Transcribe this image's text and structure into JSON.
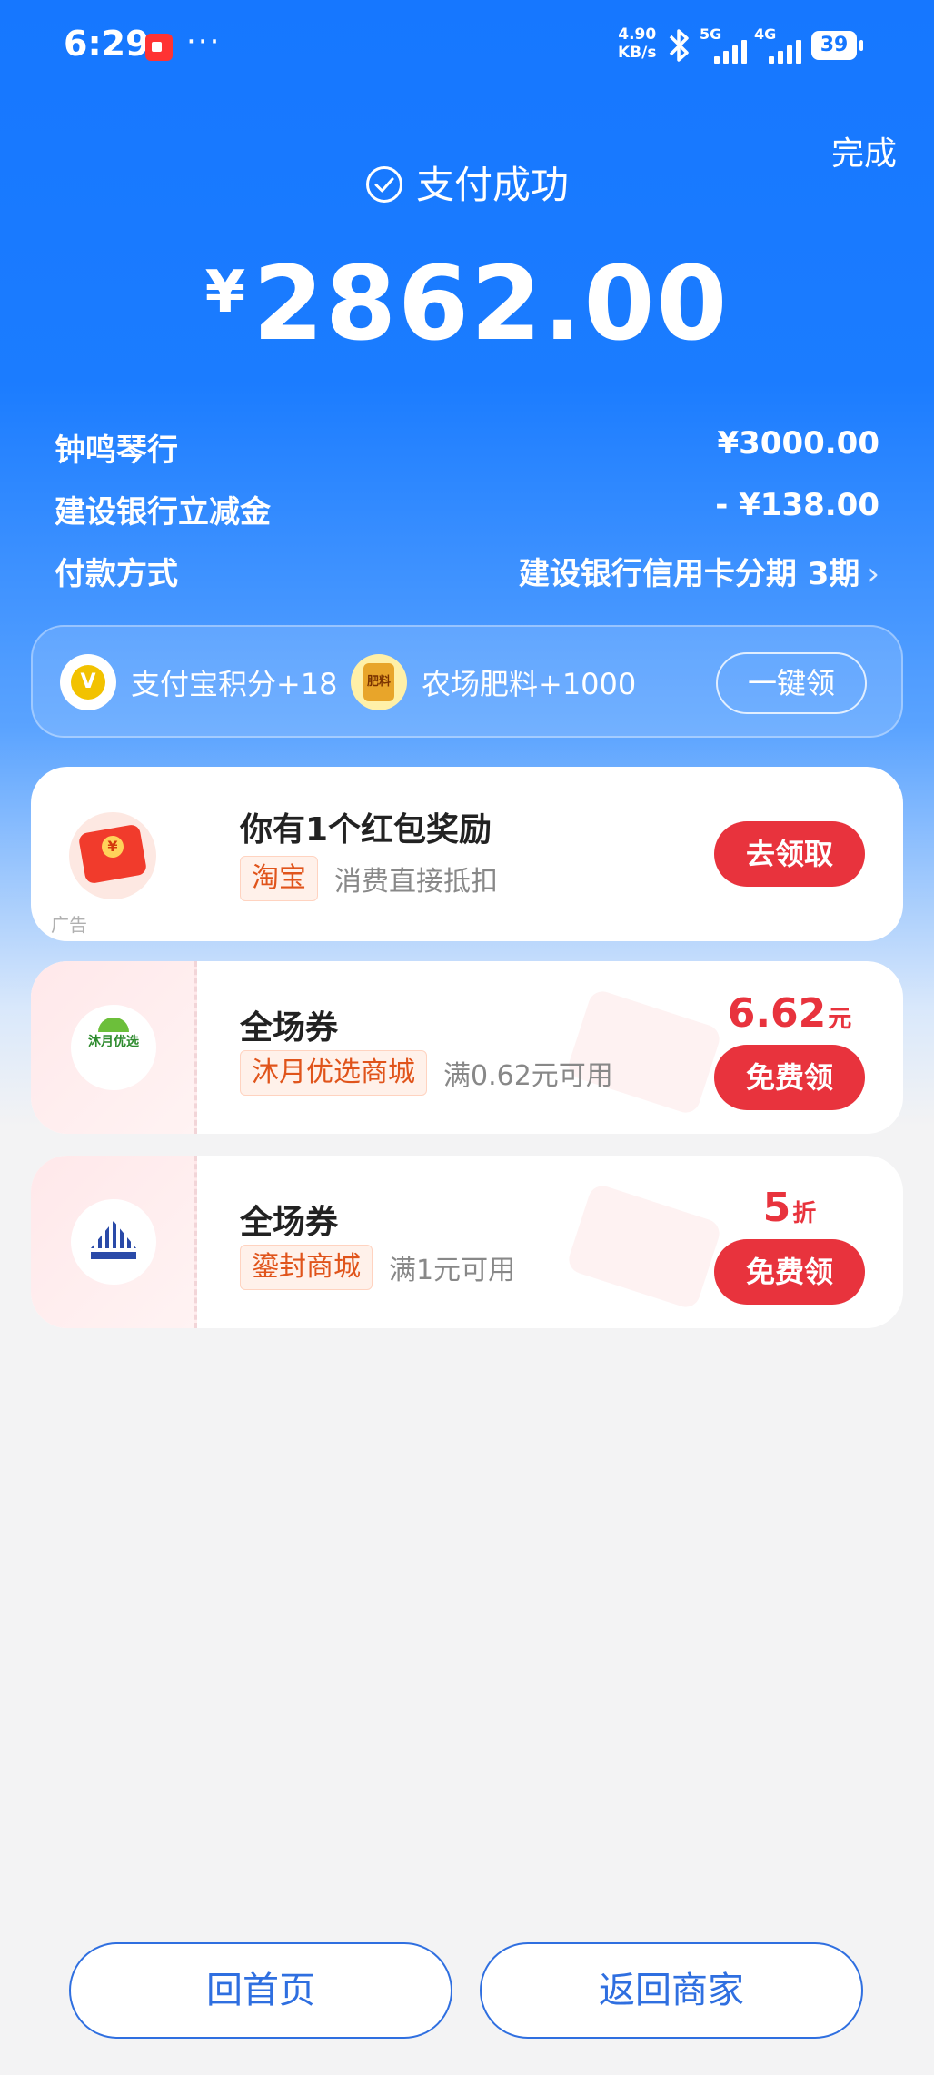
{
  "status_bar": {
    "time": "6:29",
    "more": "···",
    "net_speed_value": "4.90",
    "net_speed_unit": "KB/s",
    "sim1_label": "5G",
    "sim2_label": "4G",
    "battery": "39"
  },
  "header": {
    "done_label": "完成",
    "success_text": "支付成功",
    "currency_symbol": "¥",
    "amount": "2862.00"
  },
  "details": [
    {
      "label": "钟鸣琴行",
      "value": "¥3000.00"
    },
    {
      "label": "建设银行立减金",
      "value": "- ¥138.00"
    },
    {
      "label": "付款方式",
      "value": "建设银行信用卡分期 3期"
    }
  ],
  "rewards": {
    "items": [
      {
        "label": "支付宝积分+18",
        "icon": "alipay-points-icon"
      },
      {
        "label": "农场肥料+1000",
        "icon": "farm-fertilizer-icon"
      }
    ],
    "claim_all_label": "一键领"
  },
  "red_packet_card": {
    "title": "你有1个红包奖励",
    "shop_tag": "淘宝",
    "description": "消费直接抵扣",
    "ad_label": "广告",
    "cta_label": "去领取"
  },
  "coupons": [
    {
      "title": "全场券",
      "shop_tag": "沐月优选商城",
      "condition": "满0.62元可用",
      "value": "6.62",
      "unit": "元",
      "cta_label": "免费领"
    },
    {
      "title": "全场券",
      "shop_tag": "鎏封商城",
      "condition": "满1元可用",
      "value": "5",
      "unit": "折",
      "cta_label": "免费领"
    }
  ],
  "bottom_buttons": {
    "home_label": "回首页",
    "merchant_label": "返回商家"
  },
  "colors": {
    "primary_blue": "#1677ff",
    "cta_red": "#e8333d",
    "tag_orange": "#e0541b"
  }
}
